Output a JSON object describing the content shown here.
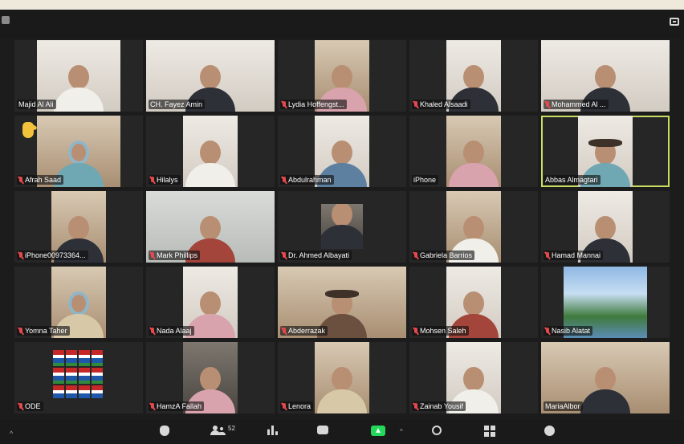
{
  "participants": [
    {
      "name": "Majid Al Ali",
      "muted": true
    },
    {
      "name": "CH. Fayez Amin",
      "muted": false
    },
    {
      "name": "Lydia Hoffengst...",
      "muted": true
    },
    {
      "name": "Khaled Alsaadi",
      "muted": true
    },
    {
      "name": "Mohammed Al ...",
      "muted": true
    },
    {
      "name": "Afrah Saad",
      "muted": true,
      "hand_raised": true
    },
    {
      "name": "Hilalys",
      "muted": true
    },
    {
      "name": "Abdulrahman",
      "muted": true
    },
    {
      "name": "iPhone",
      "muted": false
    },
    {
      "name": "Abbas Almagtari",
      "muted": false,
      "active_speaker": true
    },
    {
      "name": "iPhone00973364...",
      "muted": true
    },
    {
      "name": "Mark Phillips",
      "muted": true
    },
    {
      "name": "Dr. Ahmed Albayati",
      "muted": true
    },
    {
      "name": "Gabriela Barrios",
      "muted": true
    },
    {
      "name": "Hamad Mannai",
      "muted": true
    },
    {
      "name": "Yomna Taher",
      "muted": true
    },
    {
      "name": "Nada Alaaj",
      "muted": true
    },
    {
      "name": "Abderrazak",
      "muted": true
    },
    {
      "name": "Mohsen Saleh",
      "muted": true
    },
    {
      "name": "Nasib Alatat",
      "muted": true
    },
    {
      "name": "ODE",
      "muted": true
    },
    {
      "name": "HamzA Fallah",
      "muted": true
    },
    {
      "name": "Lenora",
      "muted": true
    },
    {
      "name": "Zainab Yousif",
      "muted": true
    },
    {
      "name": "MariaAlbor",
      "muted": false
    }
  ],
  "toolbar": {
    "participant_count": "52",
    "icons": [
      "shield-icon",
      "participants-icon",
      "polls-icon",
      "chat-icon",
      "share-screen-icon",
      "record-icon",
      "apps-icon",
      "reactions-icon"
    ],
    "accent_color": "#23d959",
    "active_speaker_color": "#c8de62",
    "muted_color": "#e5484d"
  }
}
